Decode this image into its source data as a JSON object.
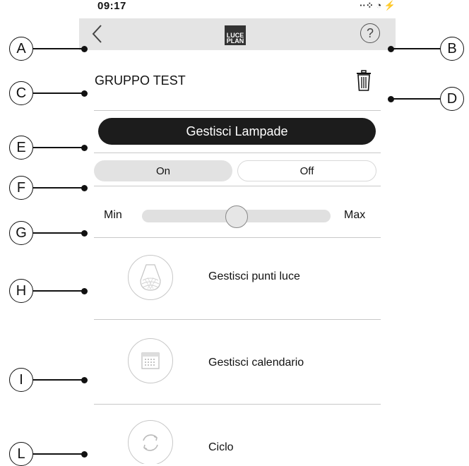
{
  "status": {
    "time": "09:17",
    "icons": "··⁘ ◔ ⚡"
  },
  "nav": {
    "logo_line1": "LUCE",
    "logo_line2": "PLAN",
    "help": "?"
  },
  "group": {
    "name": "GRUPPO TEST"
  },
  "actions": {
    "manage_lamps": "Gestisci Lampade"
  },
  "power": {
    "on": "On",
    "off": "Off",
    "selected": "On"
  },
  "dimmer": {
    "min_label": "Min",
    "max_label": "Max",
    "value_fraction": 0.5
  },
  "menu": [
    {
      "label": "Gestisci punti luce",
      "icon": "lamp-icon"
    },
    {
      "label": "Gestisci calendario",
      "icon": "calendar-icon"
    },
    {
      "label": "Ciclo",
      "icon": "cycle-icon"
    }
  ],
  "callouts": {
    "A": "A",
    "B": "B",
    "C": "C",
    "D": "D",
    "E": "E",
    "F": "F",
    "G": "G",
    "H": "H",
    "I": "I",
    "L": "L"
  }
}
